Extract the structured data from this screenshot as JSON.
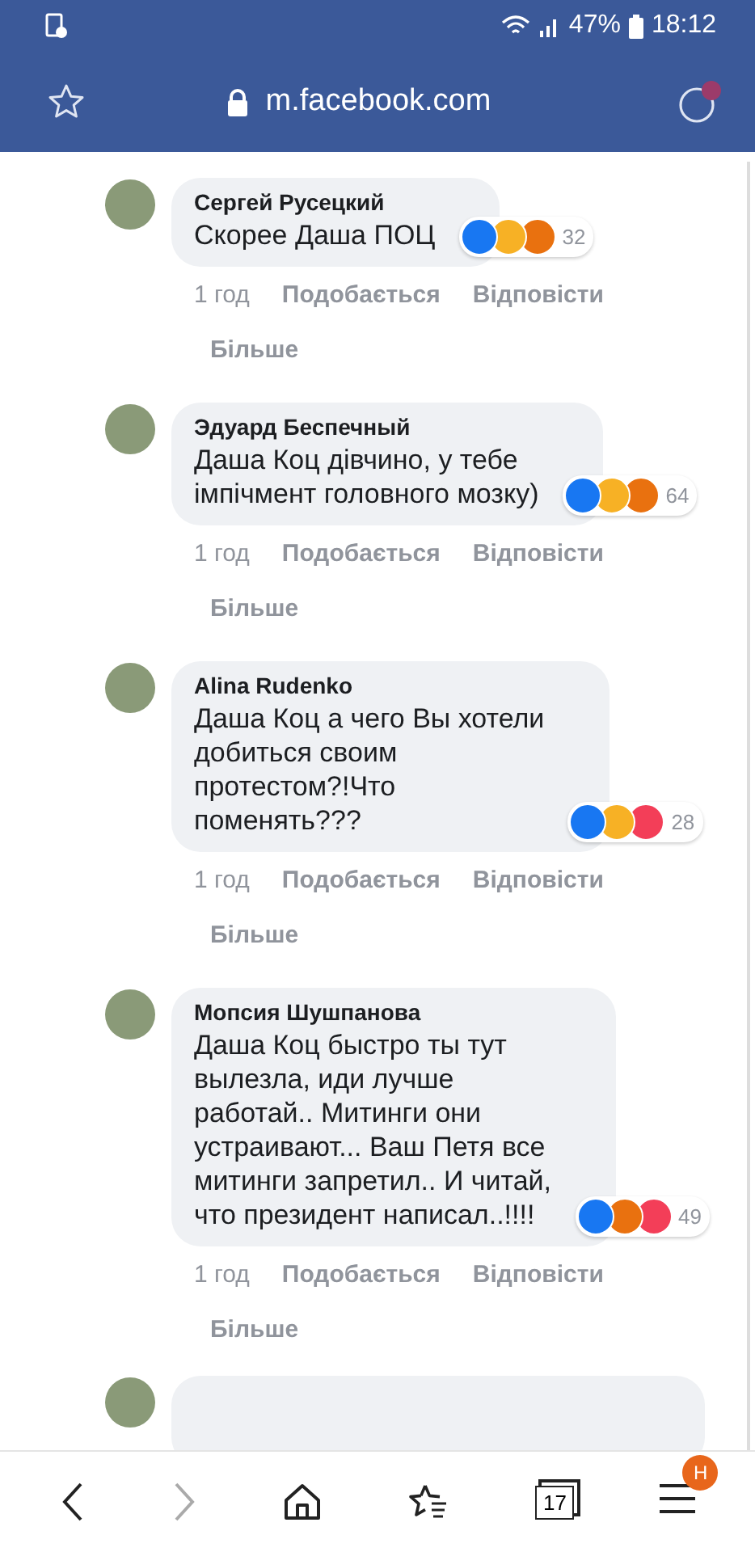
{
  "status_bar": {
    "battery": "47%",
    "time": "18:12"
  },
  "toolbar": {
    "url": "m.facebook.com",
    "secure": true
  },
  "comments": [
    {
      "author": "Сергей Русецкий",
      "text": "Скорее Даша ПОЦ",
      "reactions": [
        {
          "kind": "like"
        },
        {
          "kind": "haha"
        },
        {
          "kind": "angry"
        }
      ],
      "reaction_count": "32",
      "time": "1 год",
      "like": "Подобається",
      "reply": "Відповісти",
      "more": "Більше"
    },
    {
      "author": "Эдуард Беспечный",
      "text": "Даша Коц дівчино, у тебе\nімпічмент головного мозку)",
      "reactions": [
        {
          "kind": "like"
        },
        {
          "kind": "haha"
        },
        {
          "kind": "angry"
        }
      ],
      "reaction_count": "64",
      "time": "1 год",
      "like": "Подобається",
      "reply": "Відповісти",
      "more": "Більше"
    },
    {
      "author": "Alina Rudenko",
      "text": "Даша Коц а чего Вы хотели\nдобиться своим\nпротестом?!Что\nпоменять???",
      "reactions": [
        {
          "kind": "like"
        },
        {
          "kind": "wow"
        },
        {
          "kind": "love"
        }
      ],
      "reaction_count": "28",
      "time": "1 год",
      "like": "Подобається",
      "reply": "Відповісти",
      "more": "Більше"
    },
    {
      "author": "Мопсия Шушпанова",
      "text": "Даша Коц быстро ты тут\nвылезла, иди лучше\nработай.. Митинги они\nустраивают... Ваш Петя все\nмитинги запретил.. И читай,\nчто президент написал..!!!!",
      "reactions": [
        {
          "kind": "like"
        },
        {
          "kind": "angry"
        },
        {
          "kind": "love"
        }
      ],
      "reaction_count": "49",
      "time": "1 год",
      "like": "Подобається",
      "reply": "Відповісти",
      "more": "Більше"
    }
  ],
  "bottom_nav": {
    "forward_disabled": true,
    "tab_count": "17",
    "menu_badge": "H"
  }
}
